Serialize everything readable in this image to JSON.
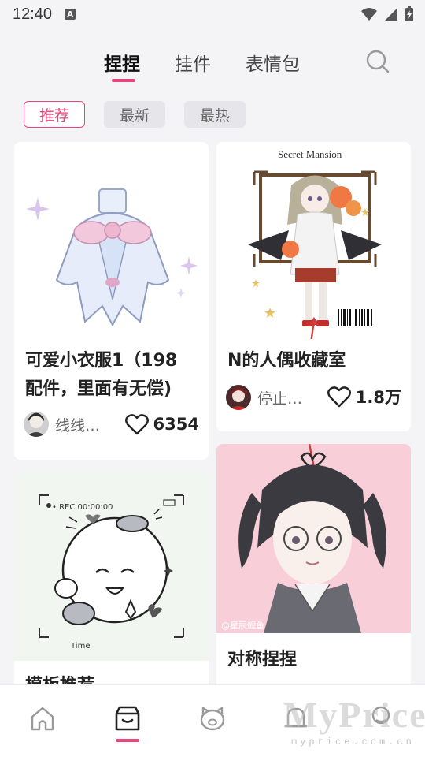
{
  "status": {
    "time": "12:40",
    "notif": "A"
  },
  "tabs": {
    "t0": "捏捏",
    "t1": "挂件",
    "t2": "表情包"
  },
  "filters": {
    "f0": "推荐",
    "f1": "最新",
    "f2": "最热"
  },
  "cards": {
    "c0": {
      "title_line1": "可爱小衣服1（198",
      "title_line2": "配件，里面有无偿)",
      "author": "线线…",
      "likes": "6354"
    },
    "c1": {
      "title": "N的人偶收藏室",
      "author": "停止…",
      "likes": "1.8万",
      "poster_title": "Secret Mansion"
    },
    "c2": {
      "title": "对称捏捏",
      "image_tag": "@星辰鲤鱼"
    },
    "c3": {
      "title": "模板推荐",
      "rec_label": "• REC 00:00:00",
      "time_label": "Time"
    }
  },
  "watermark": {
    "main": "MyPrice",
    "sub": "myprice.com.cn"
  },
  "colors": {
    "accent": "#e8467a",
    "bg": "#f4f4f6",
    "card_bg": "#ffffff"
  }
}
